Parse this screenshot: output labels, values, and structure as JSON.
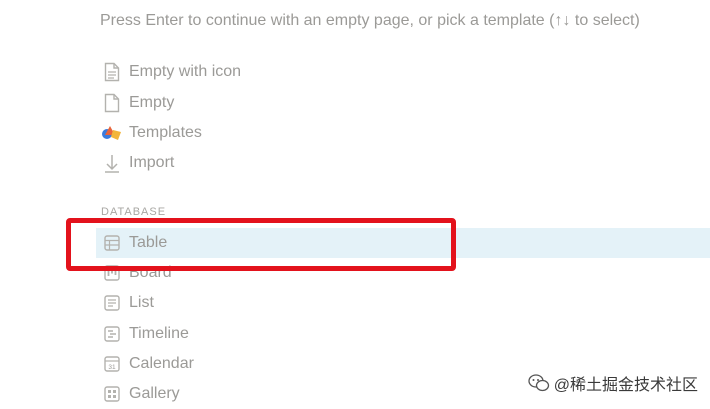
{
  "hint": "Press Enter to continue with an empty page, or pick a template (↑↓ to select)",
  "page_items": [
    {
      "label": "Empty with icon",
      "icon": "document-lines-icon"
    },
    {
      "label": "Empty",
      "icon": "document-icon"
    },
    {
      "label": "Templates",
      "icon": "templates-shapes-icon"
    },
    {
      "label": "Import",
      "icon": "arrow-down-icon"
    }
  ],
  "section_label": "DATABASE",
  "database_items": [
    {
      "label": "Table",
      "icon": "table-icon",
      "selected": true
    },
    {
      "label": "Board",
      "icon": "board-icon"
    },
    {
      "label": "List",
      "icon": "list-icon"
    },
    {
      "label": "Timeline",
      "icon": "timeline-icon"
    },
    {
      "label": "Calendar",
      "icon": "calendar-icon",
      "icon_text": "31"
    },
    {
      "label": "Gallery",
      "icon": "gallery-icon"
    }
  ],
  "watermark": "@稀土掘金技术社区",
  "colors": {
    "text": "#9b9a97",
    "selected_bg": "#e4f2f8",
    "highlight": "#e3121c"
  }
}
